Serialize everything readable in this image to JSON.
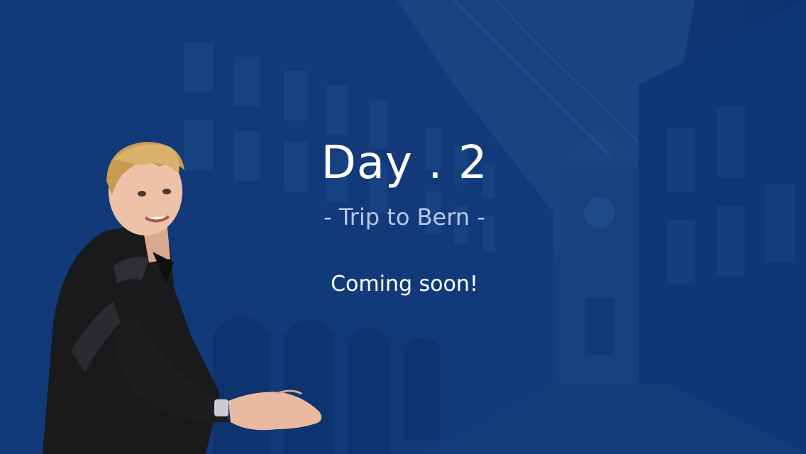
{
  "screen": {
    "title": "Day . 2",
    "subtitle": "- Trip to Bern -",
    "status": "Coming soon!"
  },
  "background": {
    "scene": "bern-old-town-street-icon",
    "tint": "#0d2f6e"
  },
  "figure": {
    "subject": "presenter-man-icon"
  }
}
